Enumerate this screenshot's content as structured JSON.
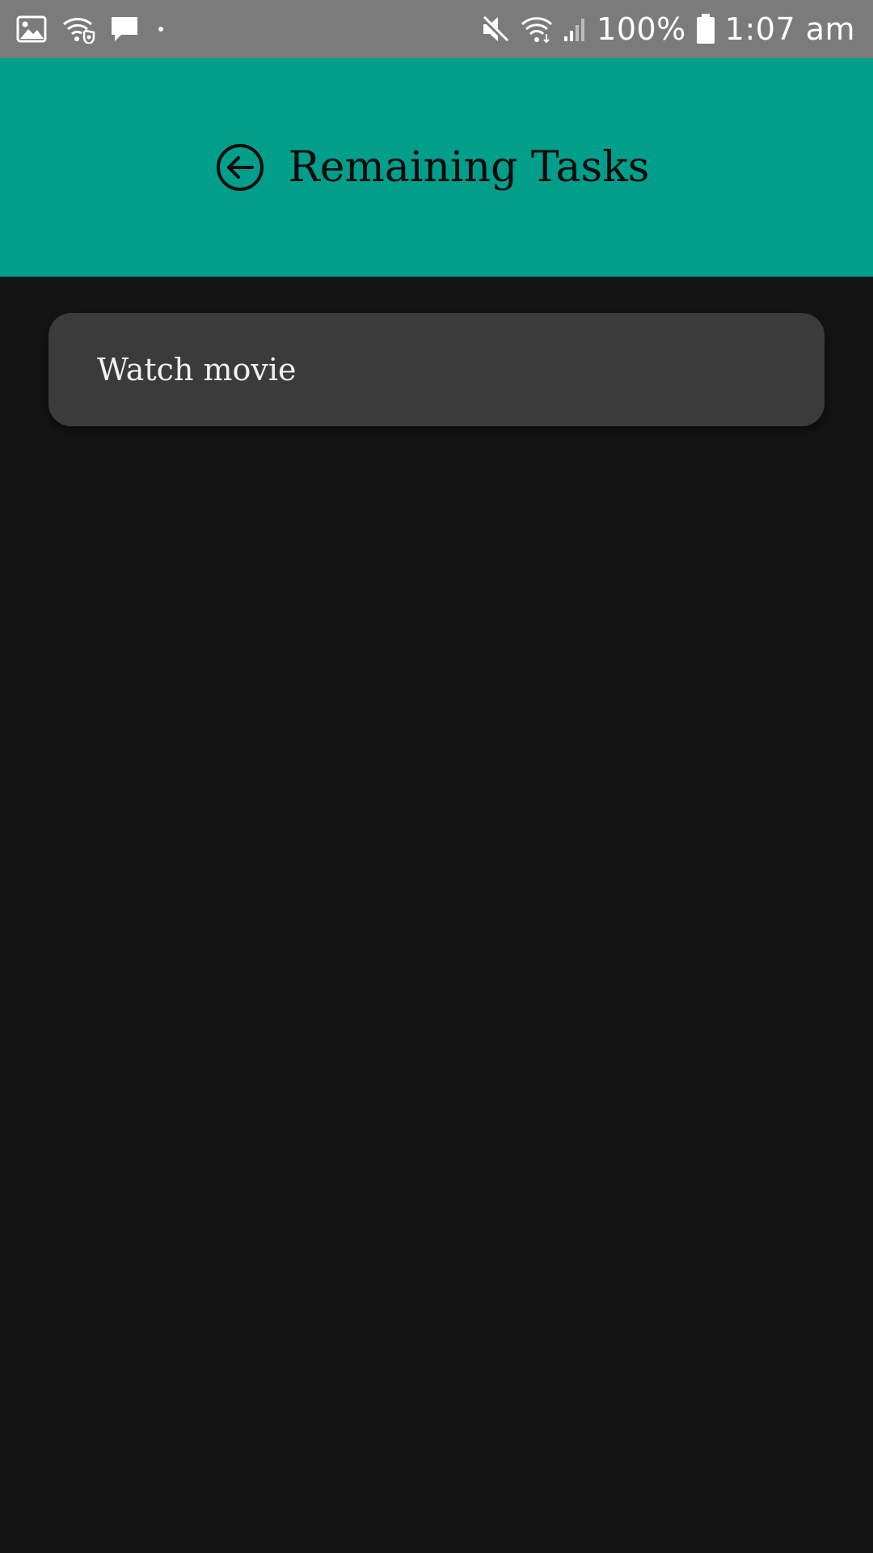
{
  "status_bar": {
    "left_icons": [
      "image-icon",
      "wifi-shield-icon",
      "message-icon",
      "dot-icon"
    ],
    "right_icons": [
      "mute-icon",
      "wifi-icon",
      "signal-icon",
      "battery-icon"
    ],
    "battery_percent": "100%",
    "time": "1:07 am"
  },
  "app_bar": {
    "back_icon": "back-arrow-circle-icon",
    "title": "Remaining Tasks",
    "background_color": "#009e8b"
  },
  "tasks": [
    {
      "label": "Watch movie"
    }
  ],
  "colors": {
    "background": "#141414",
    "card": "#3b3b3b",
    "status_bar": "#7b7b7b"
  }
}
